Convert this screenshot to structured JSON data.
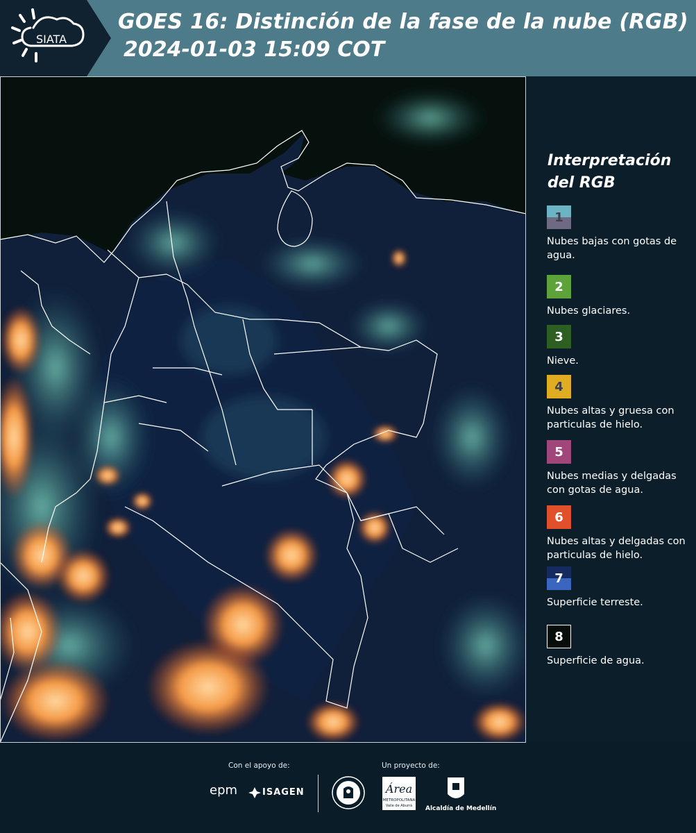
{
  "header": {
    "logo_text": "SIATA",
    "title_line1": "GOES 16: Distinción de la fase de la nube (RGB)",
    "title_line2": "2024-01-03 15:09 COT"
  },
  "legend": {
    "title": "Interpretación del RGB",
    "items": [
      {
        "number": "1",
        "text": "Nubes bajas con gotas de agua.",
        "color_top": "#6cb4c4",
        "color_bottom": "#6e6a84"
      },
      {
        "number": "2",
        "text": "Nubes glaciares.",
        "color_top": "#5ea33a",
        "color_bottom": "#5ea33a"
      },
      {
        "number": "3",
        "text": "Nieve.",
        "color_top": "#2d5f22",
        "color_bottom": "#2d5f22"
      },
      {
        "number": "4",
        "text": "Nubes altas y gruesa con particulas de hielo.",
        "color_top": "#e0ac22",
        "color_bottom": "#e0ac22"
      },
      {
        "number": "5",
        "text": "Nubes medias y delgadas con gotas de agua.",
        "color_top": "#a0467a",
        "color_bottom": "#a0467a"
      },
      {
        "number": "6",
        "text": "Nubes altas y delgadas con particulas de hielo.",
        "color_top": "#e0502a",
        "color_bottom": "#e0502a"
      },
      {
        "number": "7",
        "text": "Superficie terreste.",
        "color_top": "#152a5e",
        "color_bottom": "#3a66c0"
      },
      {
        "number": "8",
        "text": "Superficie de agua.",
        "color_top": "#050c0a",
        "color_bottom": "#050c0a"
      }
    ]
  },
  "footer": {
    "support_caption": "Con el apoyo de:",
    "project_caption": "Un proyecto de:",
    "logo_epm": "epm",
    "logo_isagen": "ISAGEN",
    "logo_area_metro": "Área",
    "logo_area_metro_sub": "METROPOLITANA",
    "logo_area_metro_sub2": "Valle de Aburrá",
    "logo_alcaldia": "Alcaldía de Medellín"
  },
  "colors": {
    "header_bg": "#4e7b89",
    "legend_bg": "#0b1e2a",
    "map_land": "#0f1e3a",
    "cloud_orange": "#f08a3a"
  }
}
